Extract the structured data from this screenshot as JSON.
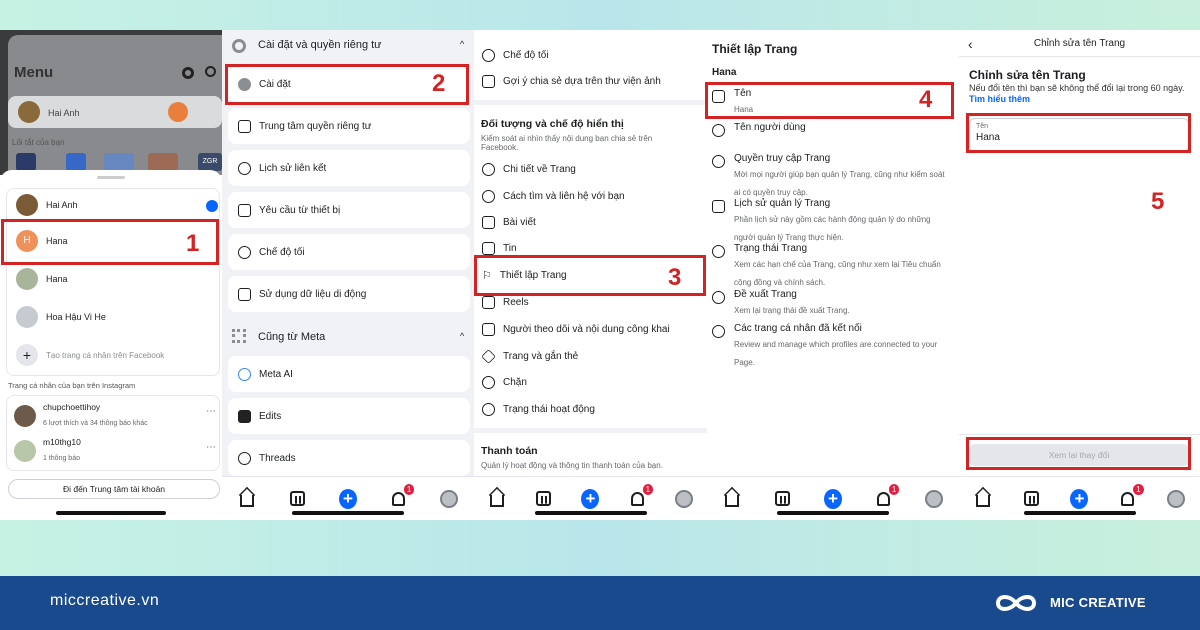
{
  "p1": {
    "menu_title": "Menu",
    "user_name": "Hai Anh",
    "shortcuts_label": "Lối tắt của bạn",
    "accounts": [
      "Hai Anh",
      "Hana",
      "Hana",
      "Hoa Hậu Vi He"
    ],
    "create_label": "Tạo trang cá nhân trên Facebook",
    "ig_section": "Trang cá nhân của bạn trên Instagram",
    "ig_accounts": [
      {
        "name": "chupchoettihoy",
        "info": "6 lượt thích và 34 thông báo khác"
      },
      {
        "name": "m10thg10",
        "info": "1 thông báo"
      }
    ],
    "center_button": "Đi đến Trung tâm tài khoản",
    "shortcut_tags": [
      "",
      "",
      "",
      "ZGR"
    ]
  },
  "p2": {
    "section1": "Cài đặt và quyền riêng tư",
    "items": [
      "Cài đặt",
      "Trung tâm quyền riêng tư",
      "Lịch sử liên kết",
      "Yêu cầu từ thiết bị",
      "Chế độ tối",
      "Sử dụng dữ liệu di động"
    ],
    "section2": "Cũng từ Meta",
    "meta_items": [
      "Meta AI",
      "Edits",
      "Threads"
    ]
  },
  "p3": {
    "top_items": [
      "Chế độ tối",
      "Gợi ý chia sẻ dựa trên thư viện ảnh"
    ],
    "section_title": "Đối tượng và chế độ hiển thị",
    "section_desc": "Kiểm soát ai nhìn thấy nội dung bạn chia sẻ trên Facebook.",
    "items": [
      "Chi tiết về Trang",
      "Cách tìm và liên hệ với bạn",
      "Bài viết",
      "Tin",
      "Thiết lập Trang",
      "Reels",
      "Người theo dõi và nội dung công khai",
      "Trang và gắn thẻ",
      "Chặn",
      "Trạng thái hoạt động"
    ],
    "pay_title": "Thanh toán",
    "pay_desc": "Quản lý hoạt động và thông tin thanh toán của bạn."
  },
  "p4": {
    "title": "Thiết lập Trang",
    "page_name": "Hana",
    "rows": [
      {
        "title": "Tên",
        "desc": "Hana"
      },
      {
        "title": "Tên người dùng",
        "desc": ""
      },
      {
        "title": "Quyền truy cập Trang",
        "desc": "Mời mọi người giúp bạn quản lý Trang, cũng như kiểm soát ai có quyền truy cập."
      },
      {
        "title": "Lịch sử quản lý Trang",
        "desc": "Phần lịch sử này gồm các hành động quản lý do những người quản lý Trang thực hiện."
      },
      {
        "title": "Trạng thái Trang",
        "desc": "Xem các hạn chế của Trang, cũng như xem lại Tiêu chuẩn cộng đồng và chính sách."
      },
      {
        "title": "Đề xuất Trang",
        "desc": "Xem lại trạng thái đề xuất Trang."
      },
      {
        "title": "Các trang cá nhân đã kết nối",
        "desc": "Review and manage which profiles are connected to your Page."
      }
    ]
  },
  "p5": {
    "header": "Chỉnh sửa tên Trang",
    "heading": "Chỉnh sửa tên Trang",
    "desc": "Nếu đổi tên thì bạn sẽ không thể đổi lại trong 60 ngày.",
    "link": "Tìm hiểu thêm",
    "field_label": "Tên",
    "field_value": "Hana",
    "review_button": "Xem lại thay đổi"
  },
  "nav": {
    "badge": "1"
  },
  "steps": [
    "1",
    "2",
    "3",
    "4",
    "5"
  ],
  "footer": {
    "site": "miccreative.vn",
    "brand": "MIC CREATIVE"
  },
  "colors": {
    "accent": "#d32323",
    "facebook_blue": "#0866ff",
    "footer_bg": "#1a4a8e"
  }
}
